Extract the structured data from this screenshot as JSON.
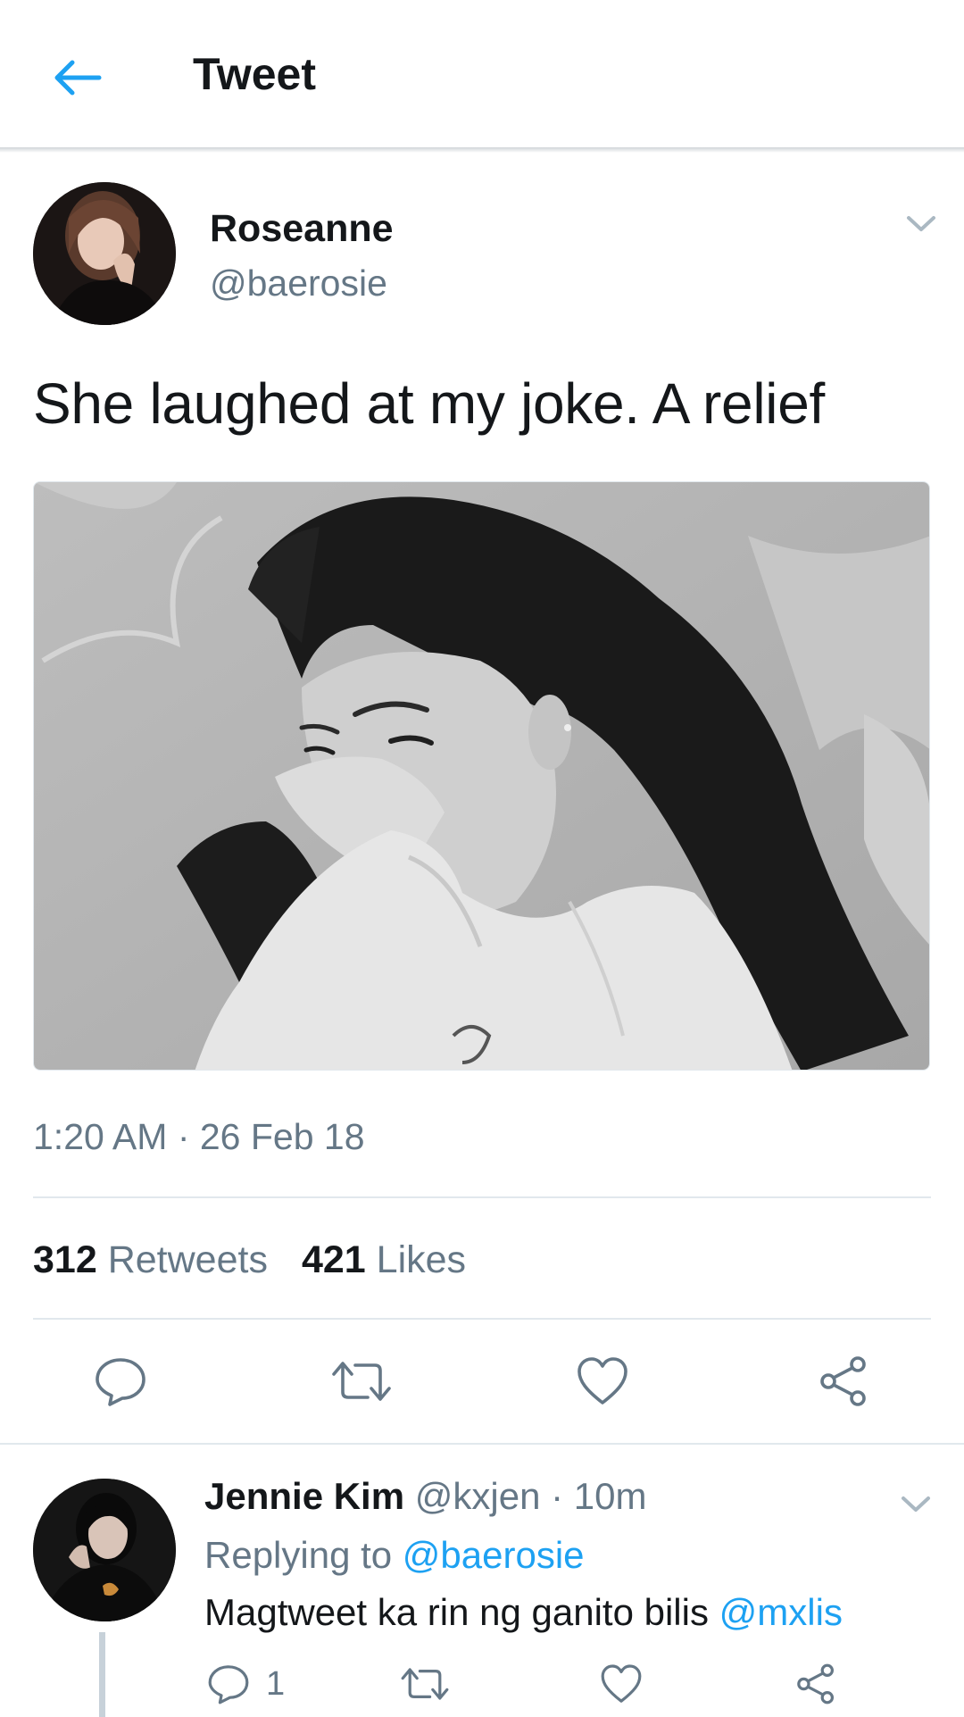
{
  "header": {
    "title": "Tweet"
  },
  "tweet": {
    "author_name": "Roseanne",
    "author_handle": "@baerosie",
    "text": "She laughed at my joke. A relief",
    "timestamp": "1:20 AM · 26 Feb 18",
    "retweets_count": "312",
    "retweets_label": "Retweets",
    "likes_count": "421",
    "likes_label": "Likes"
  },
  "reply": {
    "author_name": "Jennie Kim",
    "meta": "@kxjen · 10m",
    "replying_to_label": "Replying to",
    "replying_to_handle": "@baerosie",
    "text": "Magtweet ka rin ng ganito bilis",
    "mention": "@mxlis",
    "reply_count": "1"
  },
  "colors": {
    "accent": "#1da1f2",
    "muted": "#657786",
    "text": "#14171a",
    "divider": "#e1e8ed"
  },
  "icons": [
    "back-arrow-icon",
    "chevron-down-icon",
    "reply-icon",
    "retweet-icon",
    "like-icon",
    "share-icon"
  ]
}
